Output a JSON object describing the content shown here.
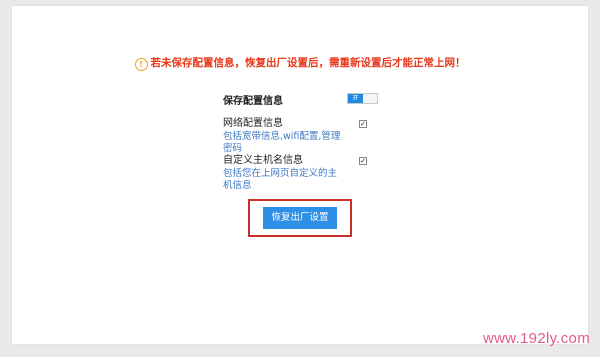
{
  "warning": {
    "icon": "info-circle-icon",
    "text": "若未保存配置信息，恢复出厂设置后，需重新设置后才能正常上网！"
  },
  "save_config": {
    "label": "保存配置信息",
    "toggle_text": "开"
  },
  "options": [
    {
      "title": "网络配置信息",
      "description": "包括宽带信息,wifi配置,管理密码",
      "checked": true
    },
    {
      "title": "自定义主机名信息",
      "description": "包括您在上网页自定义的主机信息",
      "checked": true
    }
  ],
  "restore_button": {
    "label": "恢复出厂设置"
  },
  "watermark": "www.192ly.com",
  "colors": {
    "warning": "#e8381a",
    "accent": "#2d8fe6",
    "link": "#3a78c4",
    "highlight_box": "#c9302c",
    "watermark": "#e35a8d"
  }
}
